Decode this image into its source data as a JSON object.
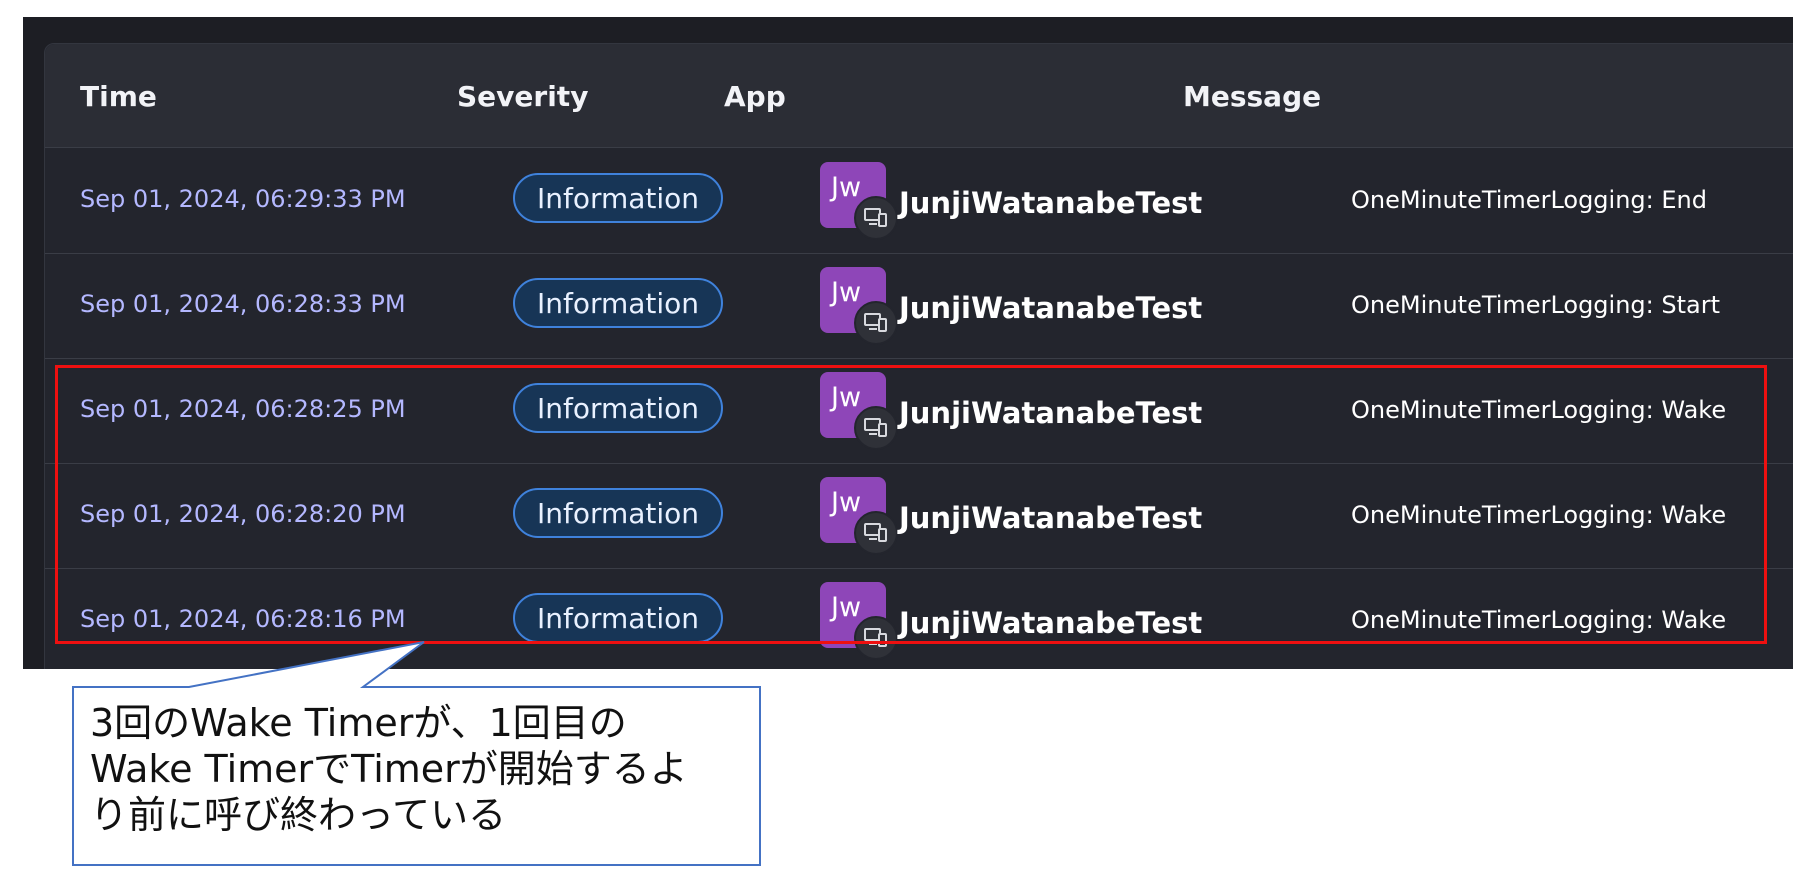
{
  "table": {
    "headers": {
      "time": "Time",
      "severity": "Severity",
      "app": "App",
      "message": "Message"
    },
    "rows": [
      {
        "time": "Sep 01, 2024, 06:29:33 PM",
        "severity": "Information",
        "app_initials": "Jw",
        "app_name": "JunjiWatanabeTest",
        "message": "OneMinuteTimerLogging: End"
      },
      {
        "time": "Sep 01, 2024, 06:28:33 PM",
        "severity": "Information",
        "app_initials": "Jw",
        "app_name": "JunjiWatanabeTest",
        "message": "OneMinuteTimerLogging: Start"
      },
      {
        "time": "Sep 01, 2024, 06:28:25 PM",
        "severity": "Information",
        "app_initials": "Jw",
        "app_name": "JunjiWatanabeTest",
        "message": "OneMinuteTimerLogging: Wake"
      },
      {
        "time": "Sep 01, 2024, 06:28:20 PM",
        "severity": "Information",
        "app_initials": "Jw",
        "app_name": "JunjiWatanabeTest",
        "message": "OneMinuteTimerLogging: Wake"
      },
      {
        "time": "Sep 01, 2024, 06:28:16 PM",
        "severity": "Information",
        "app_initials": "Jw",
        "app_name": "JunjiWatanabeTest",
        "message": "OneMinuteTimerLogging: Wake"
      }
    ]
  },
  "annotation": {
    "lines": [
      "3回のWake Timerが、1回目の",
      "Wake TimerでTimerが開始するよ",
      "り前に呼び終わっている"
    ]
  },
  "icons": {
    "app_device": "device-platform-icon"
  },
  "colors": {
    "highlight_border": "#ee1010",
    "badge_border": "#3f82dc",
    "avatar_bg": "#8e46b8",
    "time_text": "#b4b8ff",
    "callout_border": "#4472c4"
  }
}
